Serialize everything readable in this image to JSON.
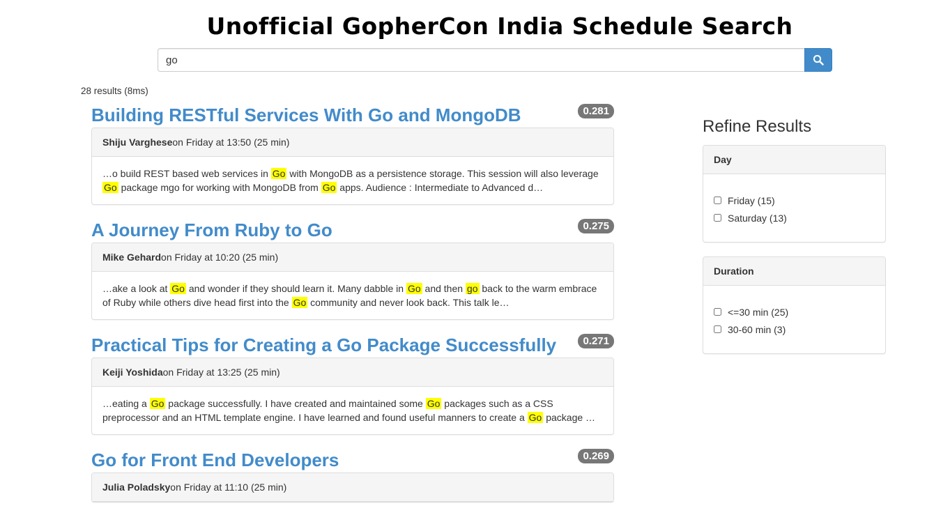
{
  "page": {
    "title": "Unofficial GopherCon India Schedule Search"
  },
  "search": {
    "value": "go",
    "button_icon": "search-icon"
  },
  "results_summary": "28 results (8ms)",
  "results": [
    {
      "title": "Building RESTful Services With Go and MongoDB",
      "score": "0.281",
      "speaker": "Shiju Varghese",
      "when": " on Friday at 13:50 (25 min)",
      "snippet": [
        {
          "t": "…o build REST based web services in "
        },
        {
          "t": "Go",
          "hl": true
        },
        {
          "t": " with MongoDB as a persistence storage. This session will also leverage "
        },
        {
          "t": "Go",
          "hl": true
        },
        {
          "t": " package mgo for working with MongoDB from "
        },
        {
          "t": "Go",
          "hl": true
        },
        {
          "t": " apps. Audience : Intermediate to Advanced d…"
        }
      ]
    },
    {
      "title": "A Journey From Ruby to Go",
      "score": "0.275",
      "speaker": "Mike Gehard",
      "when": " on Friday at 10:20 (25 min)",
      "snippet": [
        {
          "t": "…ake a look at "
        },
        {
          "t": "Go",
          "hl": true
        },
        {
          "t": " and wonder if they should learn it. Many dabble in "
        },
        {
          "t": "Go",
          "hl": true
        },
        {
          "t": " and then "
        },
        {
          "t": "go",
          "hl": true
        },
        {
          "t": " back to the warm embrace of Ruby while others dive head first into the "
        },
        {
          "t": "Go",
          "hl": true
        },
        {
          "t": " community and never look back. This talk le…"
        }
      ]
    },
    {
      "title": "Practical Tips for Creating a Go Package Successfully",
      "score": "0.271",
      "speaker": "Keiji Yoshida",
      "when": " on Friday at 13:25 (25 min)",
      "snippet": [
        {
          "t": "…eating a "
        },
        {
          "t": "Go",
          "hl": true
        },
        {
          "t": " package successfully. I have created and maintained some "
        },
        {
          "t": "Go",
          "hl": true
        },
        {
          "t": " packages such as a CSS preprocessor and an HTML template engine. I have learned and found useful manners to create a "
        },
        {
          "t": "Go",
          "hl": true
        },
        {
          "t": " package …"
        }
      ]
    },
    {
      "title": "Go for Front End Developers",
      "score": "0.269",
      "speaker": "Julia Poladsky",
      "when": " on Friday at 11:10 (25 min)",
      "snippet": []
    }
  ],
  "sidebar": {
    "title": "Refine Results",
    "facets": [
      {
        "heading": "Day",
        "options": [
          {
            "label": "Friday (15)",
            "checked": false
          },
          {
            "label": "Saturday (13)",
            "checked": false
          }
        ]
      },
      {
        "heading": "Duration",
        "options": [
          {
            "label": "<=30 min (25)",
            "checked": false
          },
          {
            "label": "30-60 min (3)",
            "checked": false
          }
        ]
      }
    ]
  }
}
